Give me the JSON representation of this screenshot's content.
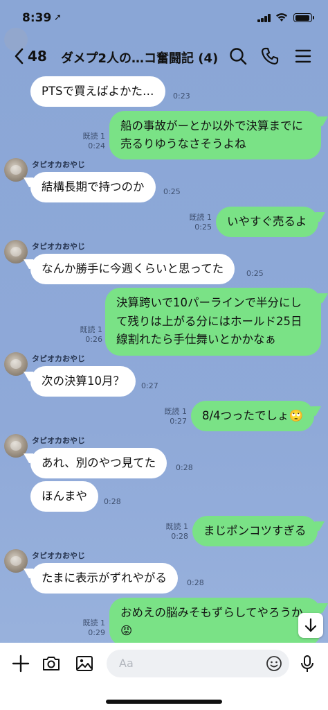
{
  "status_bar": {
    "time": "8:39",
    "location_arrow": "➚"
  },
  "header": {
    "back_count": "48",
    "title": "ダメプ2人の…コ奮闘記 (4)"
  },
  "icons": {
    "back": "chevron-left-icon",
    "search": "search-icon",
    "call": "phone-icon",
    "menu": "menu-icon",
    "add": "plus-icon",
    "camera": "camera-icon",
    "image": "image-icon",
    "emoji": "smiley-icon",
    "mic": "microphone-icon",
    "scroll": "arrow-down-icon"
  },
  "colors": {
    "outgoing_bubble": "#7ae286",
    "incoming_bubble": "#ffffff",
    "background": "#8aa6d6"
  },
  "messages": [
    {
      "dir": "in",
      "text": "PTSで買えばよかた…",
      "time": "0:23"
    },
    {
      "dir": "out",
      "line1": "船の事故がーとか以外で決算までに",
      "line2": "売るりゆうなさそうよね",
      "read": "既読 1",
      "time": "0:24"
    },
    {
      "dir": "in",
      "sender": "タピオカおやじ",
      "text": "結構長期で持つのか",
      "time": "0:25"
    },
    {
      "dir": "out",
      "text": "いやすぐ売るよ",
      "read": "既読 1",
      "time": "0:25"
    },
    {
      "dir": "in",
      "sender": "タピオカおやじ",
      "text": "なんか勝手に今週くらいと思ってた",
      "time": "0:25"
    },
    {
      "dir": "out",
      "line1": "決算跨いで10パーラインで半分にし",
      "line2": "て残りは上がる分にはホールド25日",
      "line3": "線割れたら手仕舞いとかかなぁ",
      "read": "既読 1",
      "time": "0:26"
    },
    {
      "dir": "in",
      "sender": "タピオカおやじ",
      "text": "次の決算10月？",
      "time": "0:27"
    },
    {
      "dir": "out",
      "text": "8/4つったでしょ🙄",
      "read": "既読 1",
      "time": "0:27"
    },
    {
      "dir": "in",
      "sender": "タピオカおやじ",
      "text": "あれ、別のやつ見てた",
      "time": "0:28"
    },
    {
      "dir": "in",
      "text": "ほんまや",
      "time": "0:28"
    },
    {
      "dir": "out",
      "text": "まじポンコツすぎる",
      "read": "既読 1",
      "time": "0:28"
    },
    {
      "dir": "in",
      "sender": "タピオカおやじ",
      "text": "たまに表示がずれやがる",
      "time": "0:28"
    },
    {
      "dir": "out",
      "line1": "おめえの脳みそもずらしてやろうか",
      "line2": "😡",
      "read": "既読 1",
      "time": "0:29"
    }
  ],
  "input": {
    "placeholder": "Aa"
  }
}
